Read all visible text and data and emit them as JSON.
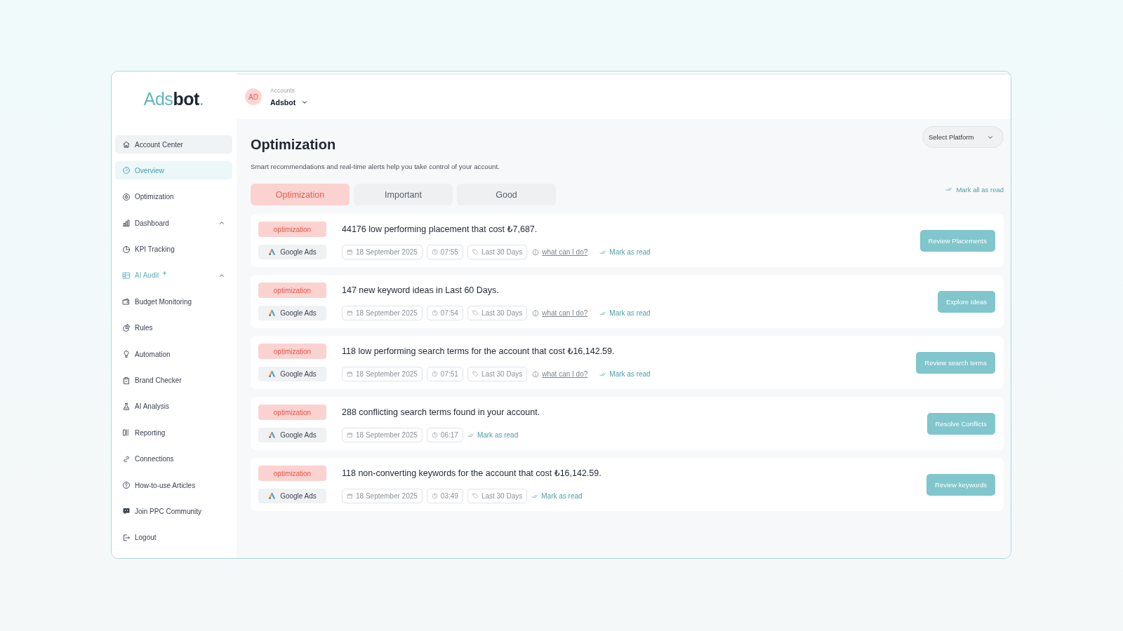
{
  "sidebar": {
    "logo": {
      "accent": "Ads",
      "main": "bot",
      "dot": "."
    },
    "account_center": {
      "label": "Account Center"
    },
    "items": [
      {
        "label": "Overview",
        "kind": "link",
        "selected": true
      },
      {
        "label": "Optimization",
        "kind": "link",
        "selected": false
      },
      {
        "label": "Dashboard",
        "kind": "link",
        "selected": false,
        "expanded": true
      },
      {
        "label": "KPI Tracking",
        "kind": "link",
        "selected": false
      },
      {
        "label": "AI Audit",
        "kind": "ai",
        "selected": false,
        "expanded": true
      },
      {
        "label": "Budget Monitoring",
        "kind": "link",
        "selected": false
      },
      {
        "label": "Rules",
        "kind": "link",
        "selected": false
      },
      {
        "label": "Automation",
        "kind": "link",
        "selected": false
      },
      {
        "label": "Brand Checker",
        "kind": "link",
        "selected": false
      },
      {
        "label": "AI Analysis",
        "kind": "link",
        "selected": false
      },
      {
        "label": "Reporting",
        "kind": "link",
        "selected": false
      },
      {
        "label": "Connections",
        "kind": "link",
        "selected": false
      },
      {
        "label": "How-to-use Articles",
        "kind": "link",
        "selected": false
      },
      {
        "label": "Join PPC Community",
        "kind": "link",
        "selected": false
      },
      {
        "label": "Logout",
        "kind": "link",
        "selected": false
      }
    ]
  },
  "header": {
    "account": {
      "initials": "AD",
      "caption": "Accounts",
      "name": "Adsbot"
    }
  },
  "page": {
    "title": "Optimization",
    "subtitle": "Smart recommendations and real-time alerts help you take control of your account.",
    "platform_select": {
      "placeholder": "Select Platform"
    },
    "tabs": [
      {
        "label": "Optimization",
        "selected": true
      },
      {
        "label": "Important",
        "selected": false
      },
      {
        "label": "Good",
        "selected": false
      }
    ],
    "mark_all_read": "Mark all as read"
  },
  "alerts": [
    {
      "tag": "optimization",
      "platform": "Google Ads",
      "title": "44176 low performing placement that cost ₺7,687.",
      "date": "18 September 2025",
      "time": "07:55",
      "period": "Last 30 Days",
      "help_link": "what can I do?",
      "mark_read": "Mark as read",
      "action": "Review Placements"
    },
    {
      "tag": "optimization",
      "platform": "Google Ads",
      "title": "147 new keyword ideas in Last 60 Days.",
      "date": "18 September 2025",
      "time": "07:54",
      "period": "Last 30 Days",
      "help_link": "what can I do?",
      "mark_read": "Mark as read",
      "action": "Explore Ideas"
    },
    {
      "tag": "optimization",
      "platform": "Google Ads",
      "title": "118 low performing search terms for the account that cost ₺16,142.59.",
      "date": "18 September 2025",
      "time": "07:51",
      "period": "Last 30 Days",
      "help_link": "what can I do?",
      "mark_read": "Mark as read",
      "action": "Review search terms"
    },
    {
      "tag": "optimization",
      "platform": "Google Ads",
      "title": "288 conflicting search terms found in your account.",
      "date": "18 September 2025",
      "time": "06:17",
      "mark_read": "Mark as read",
      "action": "Resolve Conflicts"
    },
    {
      "tag": "optimization",
      "platform": "Google Ads",
      "title": "118 non-converting keywords for the account that cost ₺16,142.59.",
      "date": "18 September 2025",
      "time": "03:49",
      "period": "Last 30 Days",
      "mark_read": "Mark as read",
      "action": "Review keywords"
    }
  ]
}
